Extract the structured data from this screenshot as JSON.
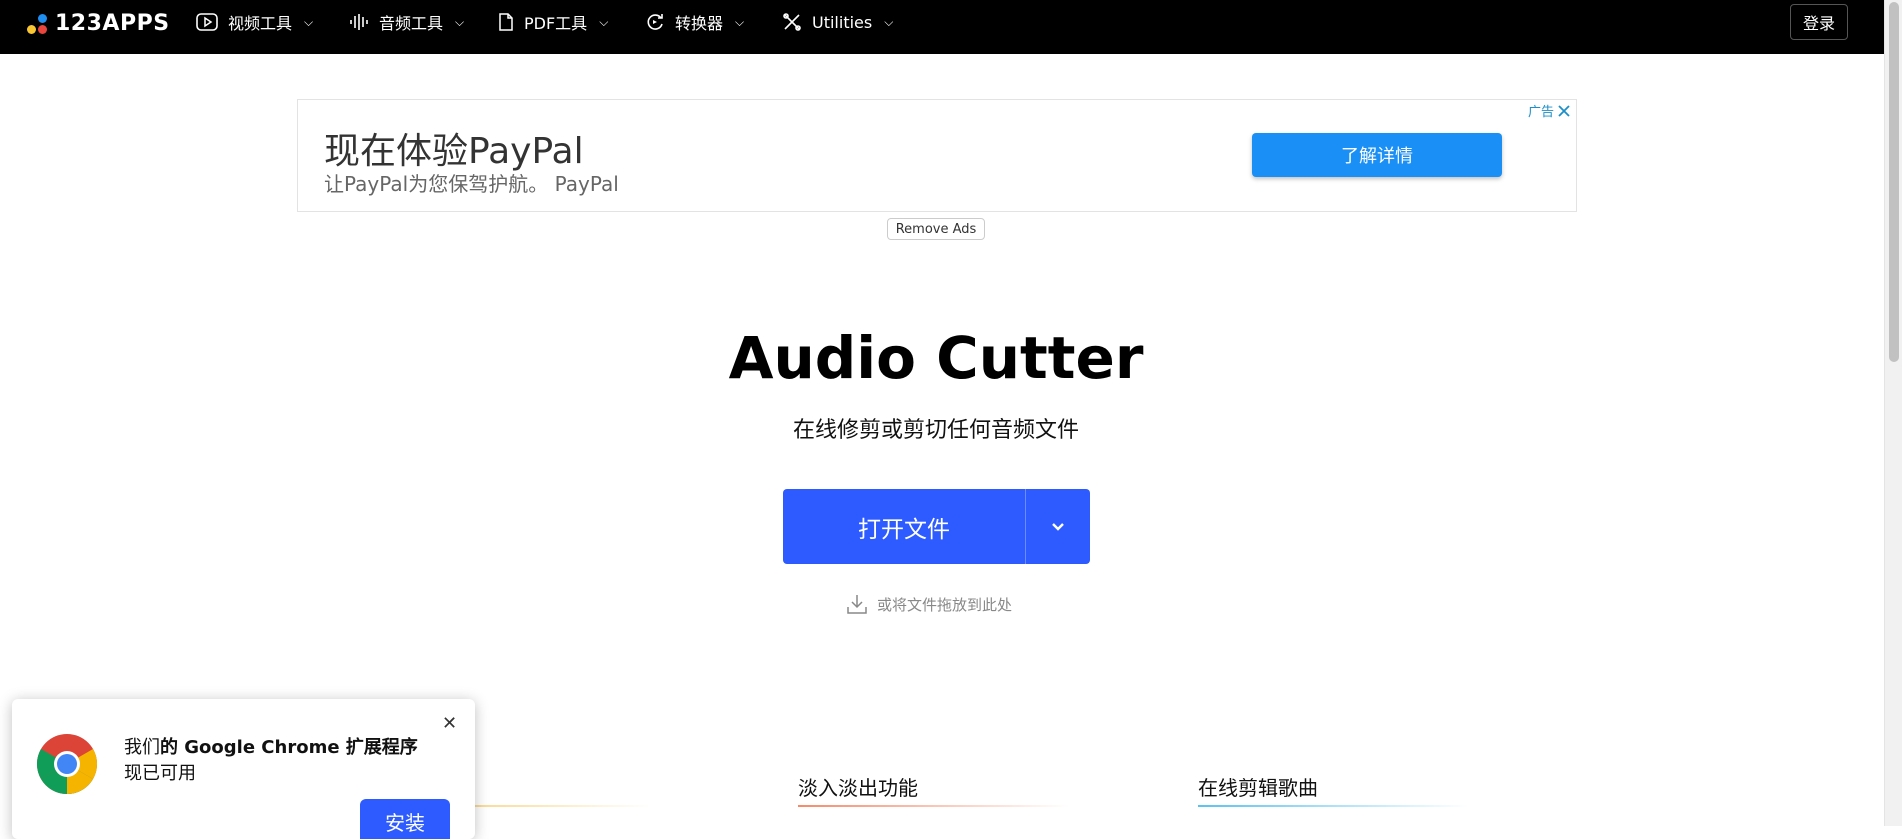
{
  "nav": {
    "logo_text": "123APPS",
    "items": [
      {
        "label": "视频工具",
        "icon": "play-icon"
      },
      {
        "label": "音频工具",
        "icon": "waveform-icon"
      },
      {
        "label": "PDF工具",
        "icon": "file-icon"
      },
      {
        "label": "转换器",
        "icon": "convert-icon"
      },
      {
        "label": "Utilities",
        "icon": "tools-icon"
      }
    ],
    "login_label": "登录"
  },
  "ad": {
    "title": "现在体验PayPal",
    "subtitle": "让PayPal为您保驾护航。 PayPal",
    "cta_label": "了解详情",
    "ad_mark": "广告",
    "remove_ads_label": "Remove Ads"
  },
  "hero": {
    "title": "Audio Cutter",
    "subtitle": "在线修剪或剪切任何音频文件",
    "open_button_label": "打开文件",
    "drop_hint": "或将文件拖放到此处"
  },
  "features": [
    {
      "label": "淡入淡出功能",
      "color": "#f58a6b"
    },
    {
      "label": "在线剪辑歌曲",
      "color": "#5bc2f0"
    }
  ],
  "chrome_popup": {
    "line1_prefix": "我们",
    "line1_bold": "的 Google Chrome 扩展程序",
    "line2": "现已可用",
    "install_label": "安装"
  },
  "colors": {
    "accent": "#2d5bff",
    "ad_cta": "#1a8ff5",
    "topbar": "#000000"
  }
}
